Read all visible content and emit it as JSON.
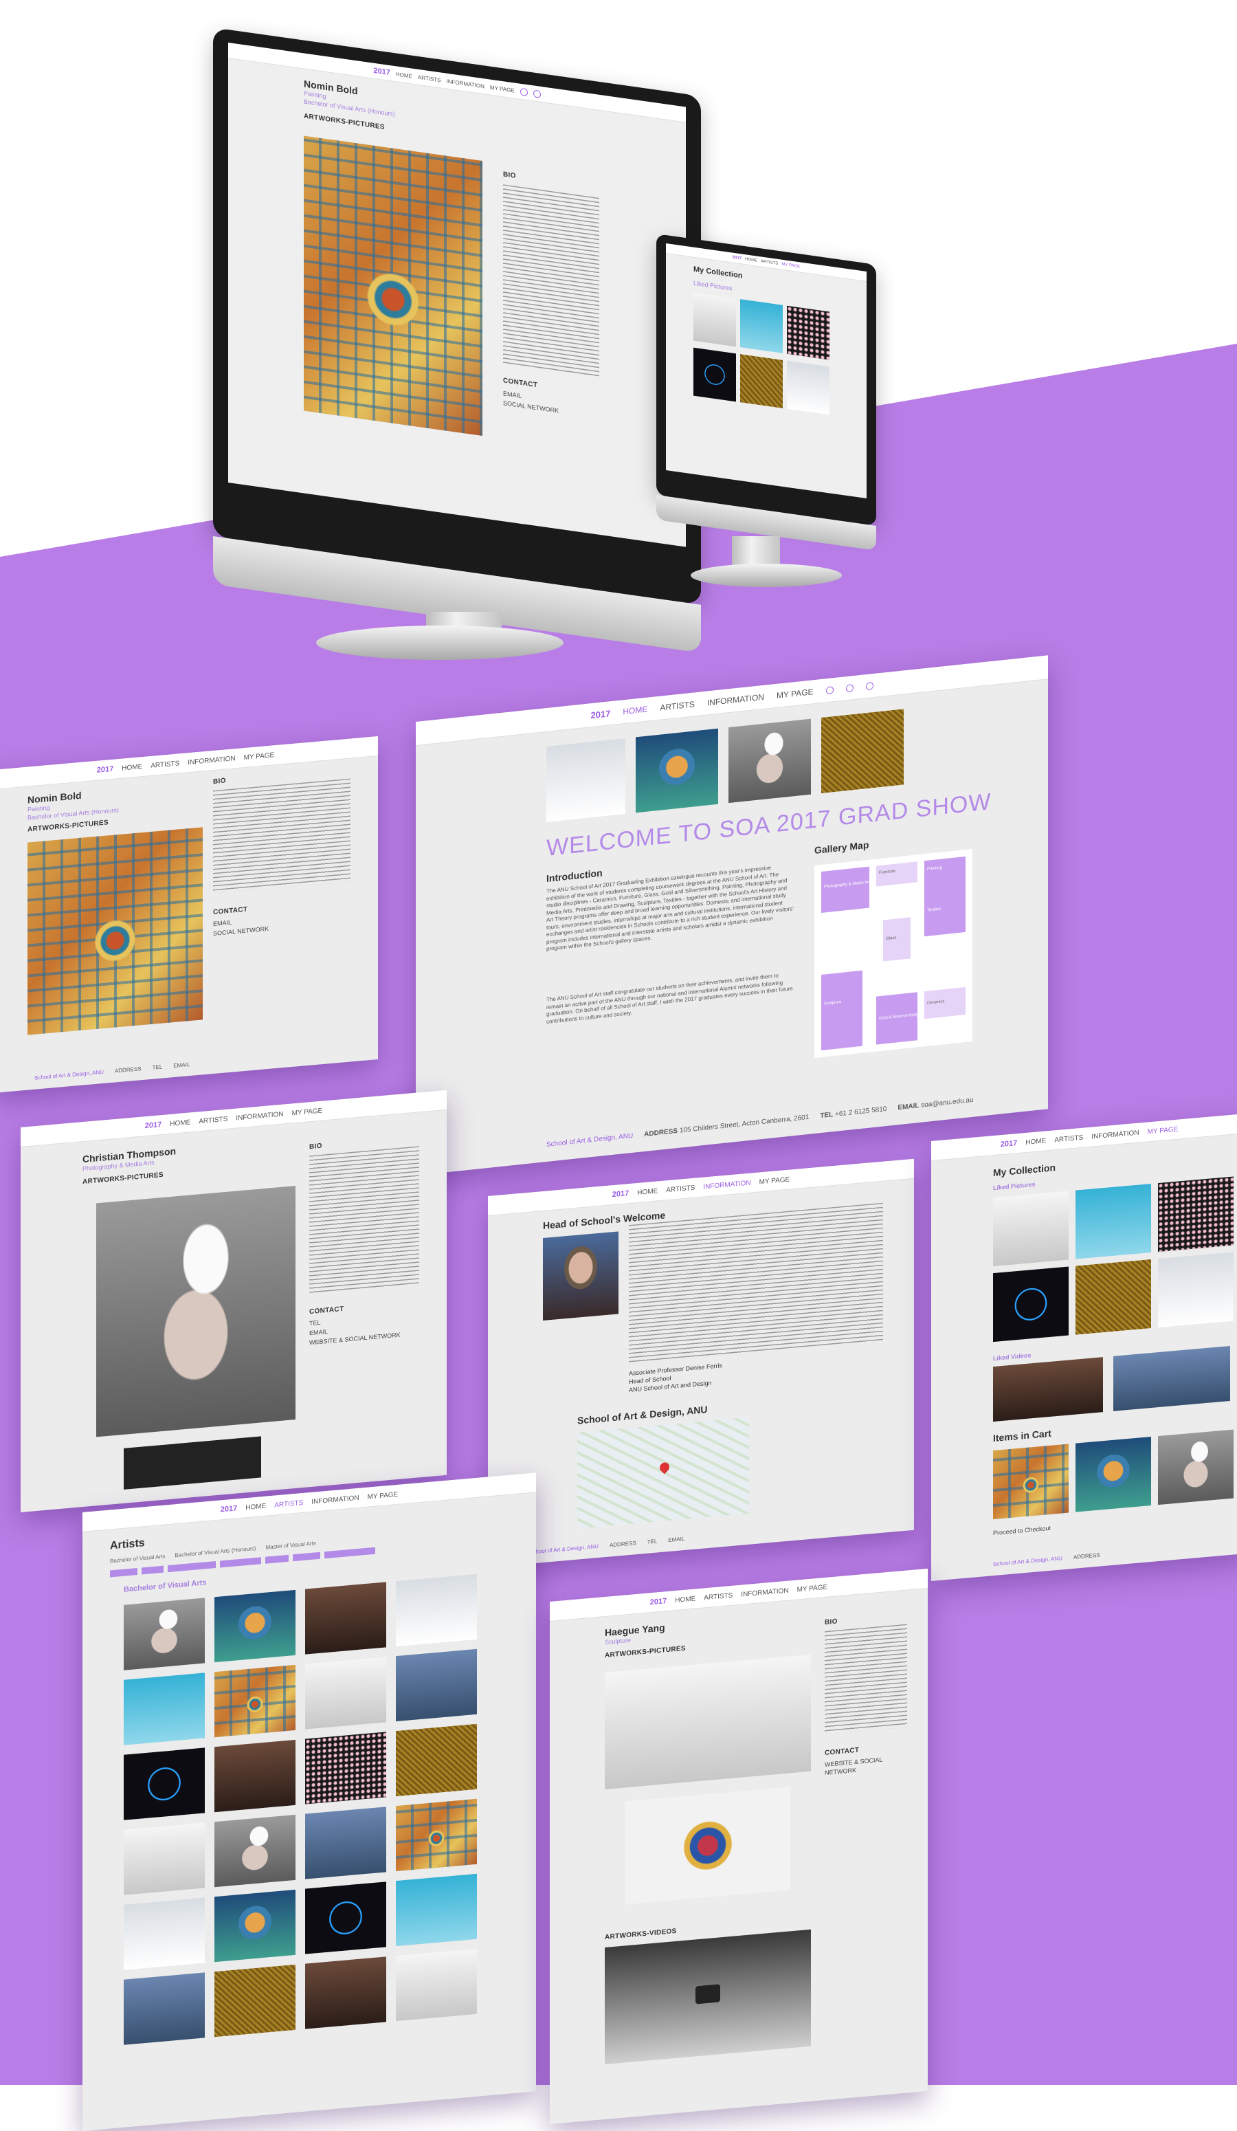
{
  "theme": {
    "accent": "#9b5de5",
    "background_purple": "#b87de6"
  },
  "nav": {
    "logo": "2017",
    "home": "HOME",
    "artists": "ARTISTS",
    "information": "INFORMATION",
    "my_page": "MY PAGE"
  },
  "artist_nomin": {
    "name": "Nomin Bold",
    "discipline": "Painting",
    "degree": "Bachelor of Visual Arts (Honours)",
    "artworks_header": "ARTWORKS-PICTURES",
    "bio_header": "BIO",
    "contact_header": "CONTACT",
    "email_label": "EMAIL",
    "social_label": "SOCIAL NETWORK"
  },
  "my_collection": {
    "title": "My Collection",
    "liked_pictures": "Liked Pictures",
    "liked_videos": "Liked Videos",
    "items_in_cart": "Items in Cart",
    "proceed": "Proceed to Checkout"
  },
  "home": {
    "welcome": "WELCOME TO SOA 2017 GRAD SHOW",
    "intro_title": "Introduction",
    "intro_text": "The ANU School of Art 2017 Graduating Exhibition catalogue recounts this year's impressive exhibition of the work of students completing coursework degrees at the ANU School of Art. The studio disciplines - Ceramics, Furniture, Glass, Gold and Silversmithing, Painting, Photography and Media Arts, Printmedia and Drawing, Sculpture, Textiles - together with the School's Art History and Art Theory programs offer deep and broad learning opportunities. Domestic and international study tours, environment studies, internships at major arts and cultural institutions, international student exchanges and artist residencies in Schools contribute to a rich student experience. Our lively visitors' program includes international and interstate artists and scholars amidst a dynamic exhibition program within the School's gallery spaces.",
    "intro_text_2": "The ANU School of Art staff congratulate our students on their achievements, and invite them to remain an active part of the ANU through our national and international Alumni networks following graduation. On behalf of all School of Art staff, I wish the 2017 graduates every success in their future contributions to culture and society.",
    "gallery_map": "Gallery Map",
    "map_labels": [
      "Photography & Media Arts",
      "Painting",
      "Sculpture",
      "Glass",
      "Textiles",
      "Gold & Silversmithing",
      "Ceramics",
      "Furniture"
    ]
  },
  "footer": {
    "school": "School of Art & Design, ANU",
    "address_label": "ADDRESS",
    "address": "105 Childers Street, Acton Canberra, 2601",
    "tel_label": "TEL",
    "tel": "+61 2 6125 5810",
    "email_label": "EMAIL",
    "email": "soa@anu.edu.au"
  },
  "artist_christian": {
    "name": "Christian Thompson",
    "discipline": "Photography & Media Arts",
    "artworks_header": "ARTWORKS-PICTURES",
    "bio_header": "BIO",
    "contact_header": "CONTACT",
    "tel_label": "TEL",
    "email_label": "EMAIL",
    "web_label": "WEBSITE & SOCIAL NETWORK"
  },
  "head_of_school": {
    "title": "Head of School's Welcome",
    "map_title": "School of Art & Design, ANU",
    "signature_1": "Associate Professor Denise Ferris",
    "signature_2": "Head of School",
    "signature_3": "ANU School of Art and Design"
  },
  "artists_page": {
    "title": "Artists",
    "filter_1": "Bachelor of Visual Arts",
    "filter_2": "Bachelor of Visual Arts (Honours)",
    "filter_3": "Master of Visual Arts",
    "section_bva": "Bachelor of Visual Arts"
  },
  "artist_haegue": {
    "name": "Haegue Yang",
    "discipline": "Sculpture",
    "artworks_header": "ARTWORKS-PICTURES",
    "videos_header": "ARTWORKS-VIDEOS",
    "bio_header": "BIO",
    "contact_header": "CONTACT",
    "web_label": "WEBSITE & SOCIAL NETWORK"
  }
}
